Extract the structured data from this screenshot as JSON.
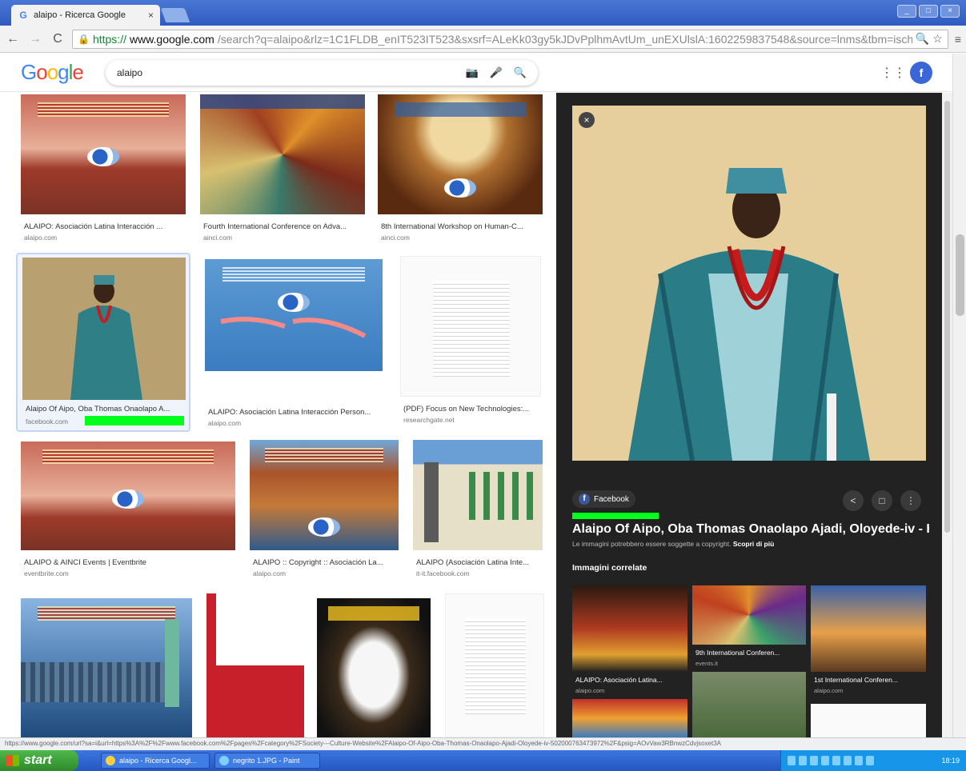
{
  "browser": {
    "tab_title": "alaipo - Ricerca Google",
    "tab_close": "×",
    "tab_favicon": "G",
    "window_buttons": [
      "_",
      "□",
      "×"
    ],
    "nav_back": "←",
    "nav_forward": "→",
    "nav_reload": "C",
    "lock": "🔒",
    "url_scheme": "https://",
    "url_host": "www.google.com",
    "url_path": "/search?q=alaipo&rlz=1C1FLDB_enIT523IT523&sxsrf=ALeKk03gy5kJDvPplhmAvtUm_unEXUlslA:1602259837548&source=lnms&tbm=isch",
    "zoom_icon": "🔍",
    "star_icon": "☆",
    "menu_icon": "≡"
  },
  "google": {
    "query": "alaipo",
    "apps_icon": "⋮⋮⋮",
    "avatar_letter": "f",
    "icons": {
      "camera": "📷",
      "mic": "🎤",
      "search": "🔍"
    }
  },
  "results": [
    {
      "caption": "ALAIPO: Asociación Latina Interacción ...",
      "domain": "alaipo.com"
    },
    {
      "caption": "Fourth International Conference on Adva...",
      "domain": "ainci.com"
    },
    {
      "caption": "8th International Workshop on Human-C...",
      "domain": "ainci.com"
    },
    {
      "caption": "Alaipo Of Aipo, Oba Thomas Onaolapo A...",
      "domain": "facebook.com"
    },
    {
      "caption": "ALAIPO: Asociación Latina Interacción Person...",
      "domain": "alaipo.com"
    },
    {
      "caption": "(PDF) Focus on New Technologies:...",
      "domain": "researchgate.net"
    },
    {
      "caption": "ALAIPO & AINCI Events | Eventbrite",
      "domain": "eventbrite.com"
    },
    {
      "caption": "ALAIPO :: Copyright :: Asociación La...",
      "domain": "alaipo.com"
    },
    {
      "caption": "ALAIPO (Asociación Latina Inte...",
      "domain": "it-it.facebook.com"
    }
  ],
  "preview": {
    "close_icon": "×",
    "source": "Facebook",
    "source_icon_letter": "f",
    "share_icon": "<",
    "save_icon": "□",
    "more_icon": "⋮",
    "title": "Alaipo Of Aipo, Oba Thomas Onaolapo Ajadi, Oloyede-iv - H...",
    "copyright_notice": "Le immagini potrebbero essere soggette a copyright.",
    "learn_more": "Scopri di più",
    "related_heading": "Immagini correlate",
    "related": [
      {
        "caption": "ALAIPO: Asociación Latina...",
        "domain": "alaipo.com"
      },
      {
        "caption": "9th International Conferen...",
        "domain": "events.it"
      },
      {
        "caption": "1st International Conferen...",
        "domain": "alaipo.com"
      }
    ]
  },
  "status_url": "https://www.google.com/url?sa=i&url=https%3A%2F%2Fwww.facebook.com%2Fpages%2Fcategory%2FSociety---Culture-Website%2FAlaipo-Of-Aipo-Oba-Thomas-Onaolapo-Ajadi-Oloyede-iv-502000763473972%2F&psig=AOvVaw3RBnwzCdvjsoxet3A",
  "taskbar": {
    "start": "start",
    "tasks": [
      "alaipo - Ricerca Googl...",
      "negrito 1.JPG - Paint"
    ],
    "clock": "18:19"
  },
  "colors": {
    "highlight": "#00ff1a",
    "google_blue": "#4285f4",
    "preview_bg": "#222222"
  }
}
